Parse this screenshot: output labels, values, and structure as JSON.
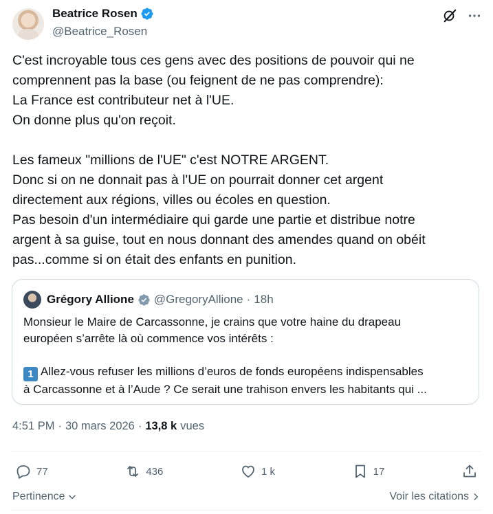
{
  "author": {
    "display_name": "Beatrice Rosen",
    "handle": "@Beatrice_Rosen"
  },
  "tweet": {
    "lines": [
      "C'est incroyable tous ces gens avec des positions de pouvoir qui ne",
      "comprennent pas la base (ou feignent de ne pas comprendre):",
      "La France est contributeur net à l'UE.",
      "On donne plus qu'on reçoit.",
      "",
      "Les fameux \"millions de l'UE\" c'est NOTRE ARGENT.",
      "Donc si on ne donnait pas à l'UE on pourrait donner cet argent",
      "directement aux régions, villes ou écoles en question.",
      "Pas besoin d'un intermédiaire qui garde une partie et distribue notre",
      "argent à sa guise, tout en nous donnant des amendes quand on obéit",
      "pas...comme si on était des enfants en punition."
    ]
  },
  "quote": {
    "display_name": "Grégory Allione",
    "handle": "@GregoryAllione",
    "separator": "·",
    "time": "18h",
    "line1": "Monsieur le Maire de Carcassonne, je crains que votre haine du drapeau",
    "line2": "européen s’arrête là où commence vos intérêts  :",
    "keycap": "1",
    "line3": "Allez-vous refuser les millions d’euros de fonds européens indispensables",
    "line4": "à Carcassonne et à l’Aude ? Ce serait une trahison envers les habitants qui ..."
  },
  "meta": {
    "time": "4:51 PM",
    "separator": "·",
    "date": "30 mars 2026",
    "separator2": "·",
    "views_count": "13,8 k",
    "views_label": "vues"
  },
  "actions": {
    "replies": "77",
    "reposts": "436",
    "likes": "1 k",
    "bookmarks": "17"
  },
  "footer": {
    "sort_label": "Pertinence",
    "quotes_label": "Voir les citations"
  },
  "colors": {
    "verified": "#1d9bf0",
    "text": "#0f1419",
    "secondary": "#536471"
  }
}
